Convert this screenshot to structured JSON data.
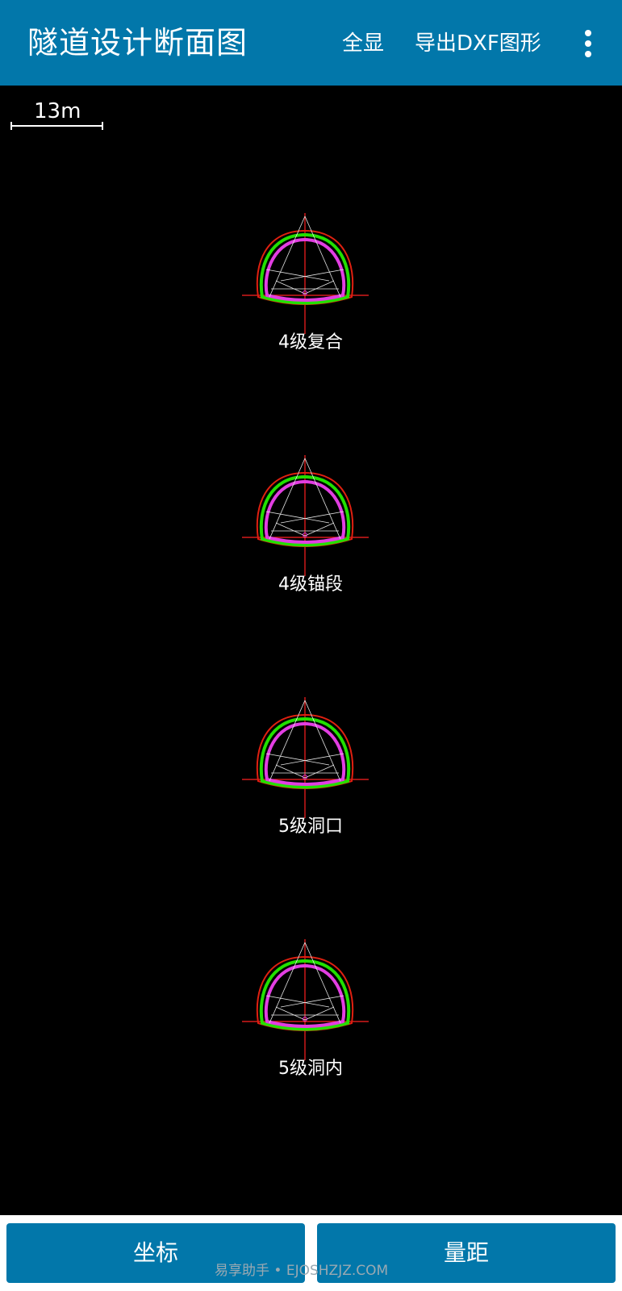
{
  "app": {
    "title": "隧道设计断面图",
    "actions": {
      "fit_all": "全显",
      "export_dxf": "导出DXF图形",
      "more": "more-vert-icon"
    }
  },
  "canvas": {
    "scale_label": "13m",
    "sections": [
      {
        "label": "4级复合"
      },
      {
        "label": "4级锚段"
      },
      {
        "label": "5级洞口"
      },
      {
        "label": "5级洞内"
      }
    ]
  },
  "buttons": {
    "coordinates": "坐标",
    "measure": "量距"
  },
  "watermark": "易享助手 • EJOSHZJZ.COM",
  "colors": {
    "appbar": "#0277aa",
    "canvas_bg": "#000000",
    "outer_lining": "#e02010",
    "middle_lining": "#22e000",
    "inner_lining": "#e23ee2",
    "axis": "#ff2020",
    "construction": "#e8e8e8"
  }
}
